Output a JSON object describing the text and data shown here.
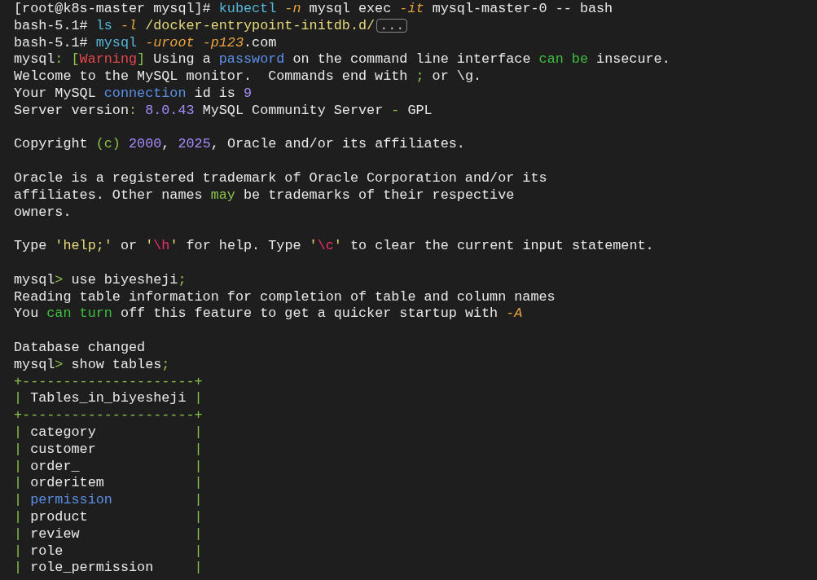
{
  "terminal": {
    "lines": [
      {
        "kind": "text",
        "segments": [
          {
            "kind": "plain",
            "text": "[root@k8s-master mysql]# "
          },
          {
            "kind": "command",
            "text": "kubectl"
          },
          {
            "kind": "flag",
            "text": " -n"
          },
          {
            "kind": "plain",
            "text": " mysql exec "
          },
          {
            "kind": "flag",
            "text": "-it"
          },
          {
            "kind": "plain",
            "text": " mysql-master-0 -- bash"
          }
        ]
      },
      {
        "kind": "text",
        "segments": [
          {
            "kind": "plain",
            "text": "bash-5.1# "
          },
          {
            "kind": "command",
            "text": "ls"
          },
          {
            "kind": "flag",
            "text": " -l"
          },
          {
            "kind": "path",
            "text": " /docker-entrypoint-initdb.d/"
          },
          {
            "kind": "marker",
            "text": "..."
          }
        ]
      },
      {
        "kind": "text",
        "segments": [
          {
            "kind": "plain",
            "text": "bash-5.1# "
          },
          {
            "kind": "command",
            "text": "mysql"
          },
          {
            "kind": "flag",
            "text": " -uroot -p123"
          },
          {
            "kind": "plain",
            "text": ".com"
          }
        ]
      },
      {
        "kind": "text",
        "segments": [
          {
            "kind": "plain",
            "text": "mysql"
          },
          {
            "kind": "punct",
            "text": ": ["
          },
          {
            "kind": "warning",
            "text": "Warning"
          },
          {
            "kind": "punct",
            "text": "]"
          },
          {
            "kind": "plain",
            "text": " Using a "
          },
          {
            "kind": "keyword",
            "text": "password"
          },
          {
            "kind": "plain",
            "text": " on the command line interface "
          },
          {
            "kind": "builtin",
            "text": "can be"
          },
          {
            "kind": "plain",
            "text": " insecure."
          }
        ]
      },
      {
        "kind": "text",
        "segments": [
          {
            "kind": "plain",
            "text": "Welcome to the MySQL monitor.  Commands end with "
          },
          {
            "kind": "punct",
            "text": ";"
          },
          {
            "kind": "plain",
            "text": " or \\g."
          }
        ]
      },
      {
        "kind": "text",
        "segments": [
          {
            "kind": "plain",
            "text": "Your MySQL "
          },
          {
            "kind": "keyword",
            "text": "connection"
          },
          {
            "kind": "plain",
            "text": " id is "
          },
          {
            "kind": "number",
            "text": "9"
          }
        ]
      },
      {
        "kind": "text",
        "segments": [
          {
            "kind": "plain",
            "text": "Server version"
          },
          {
            "kind": "punct",
            "text": ":"
          },
          {
            "kind": "number",
            "text": " 8.0.43"
          },
          {
            "kind": "plain",
            "text": " MySQL Community Server "
          },
          {
            "kind": "punct",
            "text": "-"
          },
          {
            "kind": "plain",
            "text": " GPL"
          }
        ]
      },
      {
        "kind": "blank"
      },
      {
        "kind": "text",
        "segments": [
          {
            "kind": "plain",
            "text": "Copyright "
          },
          {
            "kind": "punct",
            "text": "(c)"
          },
          {
            "kind": "number",
            "text": " 2000"
          },
          {
            "kind": "plain",
            "text": ", "
          },
          {
            "kind": "number",
            "text": "2025"
          },
          {
            "kind": "plain",
            "text": ", Oracle and/or its affiliates."
          }
        ]
      },
      {
        "kind": "blank"
      },
      {
        "kind": "text",
        "segments": [
          {
            "kind": "plain",
            "text": "Oracle is a registered trademark of Oracle Corporation and/or its"
          }
        ]
      },
      {
        "kind": "text",
        "segments": [
          {
            "kind": "plain",
            "text": "affiliates. Other names "
          },
          {
            "kind": "punct",
            "text": "may"
          },
          {
            "kind": "plain",
            "text": " be trademarks of their respective"
          }
        ]
      },
      {
        "kind": "text",
        "segments": [
          {
            "kind": "plain",
            "text": "owners."
          }
        ]
      },
      {
        "kind": "blank"
      },
      {
        "kind": "text",
        "segments": [
          {
            "kind": "plain",
            "text": "Type "
          },
          {
            "kind": "string",
            "text": "'help;'"
          },
          {
            "kind": "plain",
            "text": " or "
          },
          {
            "kind": "string",
            "text": "'"
          },
          {
            "kind": "escape",
            "text": "\\h"
          },
          {
            "kind": "string",
            "text": "'"
          },
          {
            "kind": "plain",
            "text": " for help. Type "
          },
          {
            "kind": "string",
            "text": "'"
          },
          {
            "kind": "escape",
            "text": "\\c"
          },
          {
            "kind": "string",
            "text": "'"
          },
          {
            "kind": "plain",
            "text": " to clear the current input statement."
          }
        ]
      },
      {
        "kind": "blank"
      },
      {
        "kind": "text",
        "segments": [
          {
            "kind": "plain",
            "text": "mysql"
          },
          {
            "kind": "punct",
            "text": ">"
          },
          {
            "kind": "plain",
            "text": " use biyesheji"
          },
          {
            "kind": "punct",
            "text": ";"
          }
        ]
      },
      {
        "kind": "text",
        "segments": [
          {
            "kind": "plain",
            "text": "Reading table information for completion of table and column names"
          }
        ]
      },
      {
        "kind": "text",
        "segments": [
          {
            "kind": "plain",
            "text": "You "
          },
          {
            "kind": "builtin",
            "text": "can turn"
          },
          {
            "kind": "plain",
            "text": " off this feature to get a quicker startup with "
          },
          {
            "kind": "flag",
            "text": "-A"
          }
        ]
      },
      {
        "kind": "blank"
      },
      {
        "kind": "text",
        "segments": [
          {
            "kind": "plain",
            "text": "Database changed"
          }
        ]
      },
      {
        "kind": "text",
        "segments": [
          {
            "kind": "plain",
            "text": "mysql"
          },
          {
            "kind": "punct",
            "text": ">"
          },
          {
            "kind": "plain",
            "text": " show tables"
          },
          {
            "kind": "punct",
            "text": ";"
          }
        ]
      },
      {
        "kind": "text",
        "segments": [
          {
            "kind": "punct",
            "text": "+---------------------+"
          }
        ]
      },
      {
        "kind": "text",
        "segments": [
          {
            "kind": "punct",
            "text": "|"
          },
          {
            "kind": "plain",
            "text": " Tables_in_biyesheji "
          },
          {
            "kind": "punct",
            "text": "|"
          }
        ]
      },
      {
        "kind": "text",
        "segments": [
          {
            "kind": "punct",
            "text": "+---------------------+"
          }
        ]
      },
      {
        "kind": "text",
        "segments": [
          {
            "kind": "punct",
            "text": "|"
          },
          {
            "kind": "plain",
            "text": " category            "
          },
          {
            "kind": "punct",
            "text": "|"
          }
        ]
      },
      {
        "kind": "text",
        "segments": [
          {
            "kind": "punct",
            "text": "|"
          },
          {
            "kind": "plain",
            "text": " customer            "
          },
          {
            "kind": "punct",
            "text": "|"
          }
        ]
      },
      {
        "kind": "text",
        "segments": [
          {
            "kind": "punct",
            "text": "|"
          },
          {
            "kind": "plain",
            "text": " order_              "
          },
          {
            "kind": "punct",
            "text": "|"
          }
        ]
      },
      {
        "kind": "text",
        "segments": [
          {
            "kind": "punct",
            "text": "|"
          },
          {
            "kind": "plain",
            "text": " orderitem           "
          },
          {
            "kind": "punct",
            "text": "|"
          }
        ]
      },
      {
        "kind": "text",
        "segments": [
          {
            "kind": "punct",
            "text": "|"
          },
          {
            "kind": "keyword",
            "text": " permission"
          },
          {
            "kind": "punct",
            "text": "          |"
          }
        ]
      },
      {
        "kind": "text",
        "segments": [
          {
            "kind": "punct",
            "text": "|"
          },
          {
            "kind": "plain",
            "text": " product             "
          },
          {
            "kind": "punct",
            "text": "|"
          }
        ]
      },
      {
        "kind": "text",
        "segments": [
          {
            "kind": "punct",
            "text": "|"
          },
          {
            "kind": "plain",
            "text": " review              "
          },
          {
            "kind": "punct",
            "text": "|"
          }
        ]
      },
      {
        "kind": "text",
        "segments": [
          {
            "kind": "punct",
            "text": "|"
          },
          {
            "kind": "plain",
            "text": " role                "
          },
          {
            "kind": "punct",
            "text": "|"
          }
        ]
      },
      {
        "kind": "text",
        "segments": [
          {
            "kind": "punct",
            "text": "|"
          },
          {
            "kind": "plain",
            "text": " role_permission     "
          },
          {
            "kind": "punct",
            "text": "|"
          }
        ]
      }
    ]
  }
}
